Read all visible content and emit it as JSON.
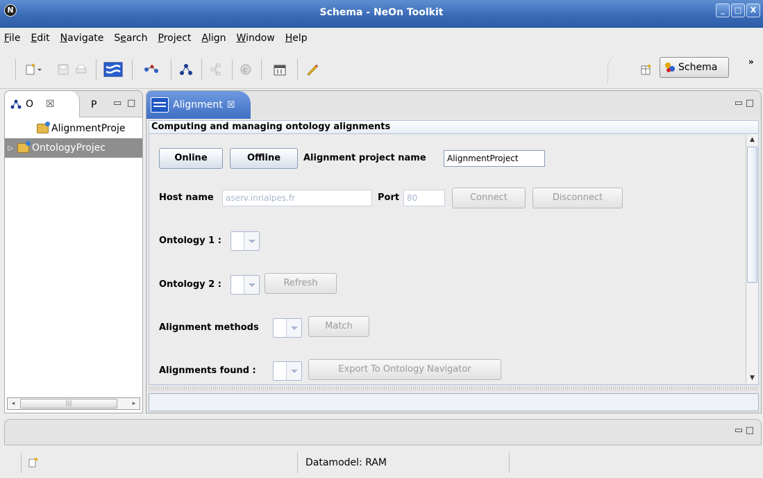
{
  "window": {
    "title": "Schema - NeOn Toolkit",
    "app_icon": "N",
    "min": "_",
    "max": "□",
    "close": "X"
  },
  "menu": [
    {
      "pre": "",
      "ul": "F",
      "post": "ile"
    },
    {
      "pre": "",
      "ul": "E",
      "post": "dit"
    },
    {
      "pre": "",
      "ul": "N",
      "post": "avigate"
    },
    {
      "pre": "S",
      "ul": "e",
      "post": "arch"
    },
    {
      "pre": "",
      "ul": "P",
      "post": "roject"
    },
    {
      "pre": "",
      "ul": "A",
      "post": "lign"
    },
    {
      "pre": "",
      "ul": "W",
      "post": "indow"
    },
    {
      "pre": "",
      "ul": "H",
      "post": "elp"
    }
  ],
  "toolbar": {
    "icons": [
      "new-wizard-icon",
      "save-icon",
      "print-icon",
      "alignment-view-icon",
      "ontology-tool-icon",
      "ontology-navigator-icon",
      "hierarchy-icon",
      "copyright-icon",
      "calendar-icon",
      "pen-icon"
    ],
    "perspective_label": "Schema",
    "more": "»"
  },
  "left_view": {
    "tab_active_letter": "O",
    "tab_close": "☒",
    "tab_other": "P",
    "minimize": "▭",
    "maximize": "□",
    "items": [
      {
        "label": "AlignmentProje",
        "expander": ""
      },
      {
        "label": "OntologyProjec",
        "expander": "▷"
      }
    ],
    "scroll_left": "◂",
    "scroll_right": "▸",
    "scroll_grip": "|||"
  },
  "editor": {
    "tab_label": "Alignment",
    "tab_close": "☒",
    "minimize": "▭",
    "maximize": "□",
    "heading": "Computing and managing ontology alignments",
    "online": "Online",
    "offline": "Offline",
    "project_name_label": "Alignment project name",
    "project_name_value": "AlignmentProject",
    "host_label": "Host name",
    "host_value": "aserv.inrialpes.fr",
    "port_label": "Port",
    "port_value": "80",
    "connect": "Connect",
    "disconnect": "Disconnect",
    "ontology1_label": "Ontology 1 :",
    "ontology2_label": "Ontology 2 :",
    "refresh": "Refresh",
    "methods_label": "Alignment methods",
    "match": "Match",
    "found_label": "Alignments found :",
    "export": "Export To Ontology Navigator",
    "scroll_up": "▲",
    "scroll_down": "▼"
  },
  "bottom": {
    "minimize": "▭",
    "maximize": "□"
  },
  "status": {
    "datamodel": "Datamodel: RAM"
  }
}
